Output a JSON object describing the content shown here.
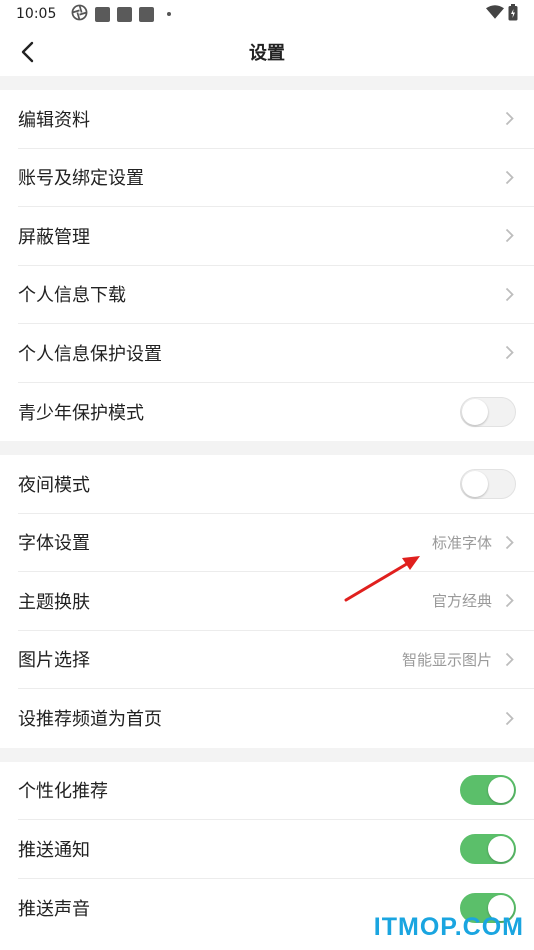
{
  "status_bar": {
    "time": "10:05"
  },
  "nav": {
    "title": "设置"
  },
  "groups": [
    {
      "rows": [
        {
          "label": "编辑资料",
          "kind": "link"
        },
        {
          "label": "账号及绑定设置",
          "kind": "link"
        },
        {
          "label": "屏蔽管理",
          "kind": "link"
        },
        {
          "label": "个人信息下载",
          "kind": "link"
        },
        {
          "label": "个人信息保护设置",
          "kind": "link"
        },
        {
          "label": "青少年保护模式",
          "kind": "toggle",
          "on": false
        }
      ]
    },
    {
      "rows": [
        {
          "label": "夜间模式",
          "kind": "toggle",
          "on": false
        },
        {
          "label": "字体设置",
          "kind": "link",
          "value": "标准字体"
        },
        {
          "label": "主题换肤",
          "kind": "link",
          "value": "官方经典"
        },
        {
          "label": "图片选择",
          "kind": "link",
          "value": "智能显示图片"
        },
        {
          "label": "设推荐频道为首页",
          "kind": "link"
        }
      ]
    },
    {
      "rows": [
        {
          "label": "个性化推荐",
          "kind": "toggle",
          "on": true
        },
        {
          "label": "推送通知",
          "kind": "toggle",
          "on": true
        },
        {
          "label": "推送声音",
          "kind": "toggle",
          "on": true
        }
      ]
    }
  ],
  "watermark": "ITMOP.COM",
  "colors": {
    "toggle_on": "#5bbf6a",
    "annotation_arrow": "#e0201e",
    "watermark": "#1aa5e0"
  }
}
